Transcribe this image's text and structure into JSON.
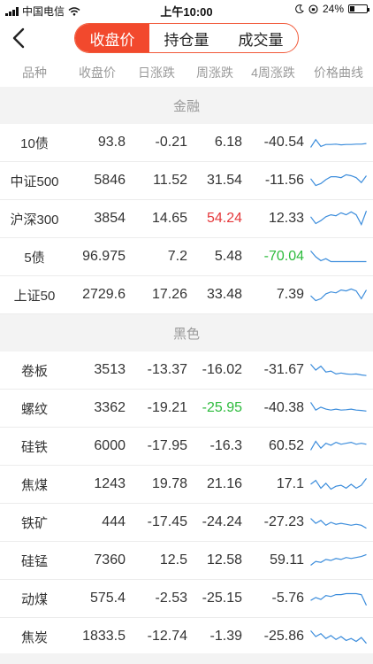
{
  "status": {
    "carrier": "中国电信",
    "time": "上午10:00",
    "battery": "24%",
    "battery_level": 0.24
  },
  "nav": {
    "back_icon": "chevron-left-icon",
    "tabs": [
      {
        "label": "收盘价",
        "active": true
      },
      {
        "label": "持仓量",
        "active": false
      },
      {
        "label": "成交量",
        "active": false
      }
    ]
  },
  "columns": {
    "name": "品种",
    "close": "收盘价",
    "day": "日涨跌",
    "week": "周涨跌",
    "week4": "4周涨跌",
    "curve": "价格曲线"
  },
  "colors": {
    "accent": "#f2492d",
    "up": "#e5383b",
    "down": "#2dbb3d",
    "curve": "#3c8ddc"
  },
  "sections": [
    {
      "title": "金融",
      "rows": [
        {
          "name": "10债",
          "close": "93.8",
          "day": "-0.21",
          "week": "6.18",
          "week4": "-40.54",
          "curve": [
            0.75,
            0.35,
            0.7,
            0.6,
            0.6,
            0.58,
            0.62,
            0.6,
            0.6,
            0.58,
            0.58,
            0.55
          ]
        },
        {
          "name": "中证500",
          "close": "5846",
          "day": "11.52",
          "week": "31.54",
          "week4": "-11.56",
          "curve": [
            0.4,
            0.75,
            0.65,
            0.45,
            0.3,
            0.3,
            0.35,
            0.2,
            0.25,
            0.35,
            0.6,
            0.25
          ]
        },
        {
          "name": "沪深300",
          "close": "3854",
          "day": "14.65",
          "week": "54.24",
          "week_color": "up",
          "week4": "12.33",
          "curve": [
            0.4,
            0.75,
            0.6,
            0.4,
            0.3,
            0.35,
            0.2,
            0.3,
            0.15,
            0.3,
            0.8,
            0.1
          ]
        },
        {
          "name": "5债",
          "close": "96.975",
          "day": "7.2",
          "week": "5.48",
          "week4": "-70.04",
          "week4_color": "down",
          "curve": [
            0.2,
            0.5,
            0.7,
            0.6,
            0.75,
            0.75,
            0.75,
            0.75,
            0.75,
            0.75,
            0.75,
            0.75
          ]
        },
        {
          "name": "上证50",
          "close": "2729.6",
          "day": "17.26",
          "week": "33.48",
          "week4": "7.39",
          "curve": [
            0.55,
            0.8,
            0.7,
            0.45,
            0.35,
            0.4,
            0.25,
            0.3,
            0.2,
            0.3,
            0.7,
            0.25
          ]
        }
      ]
    },
    {
      "title": "黑色",
      "rows": [
        {
          "name": "卷板",
          "close": "3513",
          "day": "-13.37",
          "week": "-16.02",
          "week4": "-31.67",
          "curve": [
            0.2,
            0.5,
            0.3,
            0.6,
            0.55,
            0.7,
            0.65,
            0.7,
            0.72,
            0.7,
            0.75,
            0.78
          ]
        },
        {
          "name": "螺纹",
          "close": "3362",
          "day": "-19.21",
          "week": "-25.95",
          "week_color": "down",
          "week4": "-40.38",
          "curve": [
            0.2,
            0.6,
            0.45,
            0.55,
            0.6,
            0.55,
            0.6,
            0.58,
            0.55,
            0.6,
            0.62,
            0.65
          ]
        },
        {
          "name": "硅铁",
          "close": "6000",
          "day": "-17.95",
          "week": "-16.3",
          "week4": "60.52",
          "curve": [
            0.7,
            0.25,
            0.6,
            0.35,
            0.45,
            0.3,
            0.4,
            0.35,
            0.3,
            0.4,
            0.35,
            0.4
          ]
        },
        {
          "name": "焦煤",
          "close": "1243",
          "day": "19.78",
          "week": "21.16",
          "week4": "17.1",
          "curve": [
            0.5,
            0.3,
            0.7,
            0.45,
            0.75,
            0.6,
            0.55,
            0.7,
            0.5,
            0.7,
            0.55,
            0.2
          ]
        },
        {
          "name": "铁矿",
          "close": "444",
          "day": "-17.45",
          "week": "-24.24",
          "week4": "-27.23",
          "curve": [
            0.3,
            0.55,
            0.4,
            0.65,
            0.5,
            0.6,
            0.55,
            0.6,
            0.65,
            0.6,
            0.65,
            0.8
          ]
        },
        {
          "name": "硅锰",
          "close": "7360",
          "day": "12.5",
          "week": "12.58",
          "week4": "59.11",
          "curve": [
            0.75,
            0.55,
            0.6,
            0.45,
            0.5,
            0.4,
            0.45,
            0.35,
            0.4,
            0.35,
            0.3,
            0.2
          ]
        },
        {
          "name": "动煤",
          "close": "575.4",
          "day": "-2.53",
          "week": "-25.15",
          "week4": "-5.76",
          "curve": [
            0.6,
            0.45,
            0.55,
            0.35,
            0.4,
            0.3,
            0.3,
            0.25,
            0.25,
            0.25,
            0.3,
            0.85
          ]
        },
        {
          "name": "焦炭",
          "close": "1833.5",
          "day": "-12.74",
          "week": "-1.39",
          "week4": "-25.86",
          "curve": [
            0.2,
            0.5,
            0.35,
            0.6,
            0.45,
            0.65,
            0.5,
            0.7,
            0.6,
            0.75,
            0.55,
            0.85
          ]
        }
      ]
    }
  ]
}
